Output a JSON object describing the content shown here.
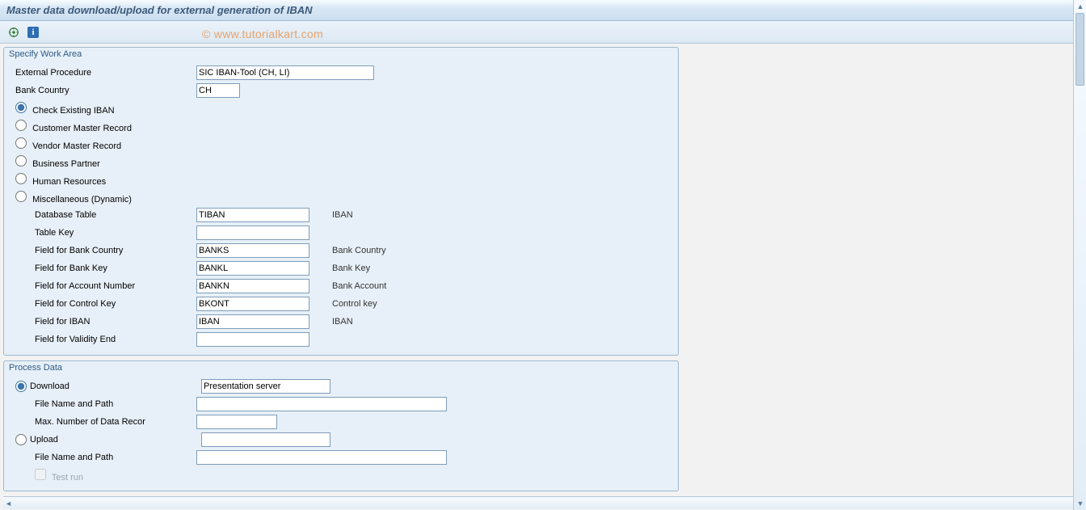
{
  "title": "Master data download/upload for external generation of IBAN",
  "watermark": "© www.tutorialkart.com",
  "groups": {
    "workarea": {
      "title": "Specify Work Area",
      "external_procedure": {
        "label": "External Procedure",
        "value": "SIC IBAN-Tool  (CH, LI)"
      },
      "bank_country": {
        "label": "Bank Country",
        "value": "CH"
      },
      "radios": {
        "check_iban": "Check Existing IBAN",
        "customer": "Customer Master Record",
        "vendor": "Vendor Master Record",
        "bp": "Business Partner",
        "hr": "Human Resources",
        "misc": "Miscellaneous (Dynamic)"
      },
      "misc_fields": {
        "db_table": {
          "label": "Database Table",
          "value": "TIBAN",
          "desc": "IBAN"
        },
        "table_key": {
          "label": "Table Key",
          "value": "",
          "desc": ""
        },
        "f_country": {
          "label": "Field for Bank Country",
          "value": "BANKS",
          "desc": "Bank Country"
        },
        "f_bankkey": {
          "label": "Field for Bank Key",
          "value": "BANKL",
          "desc": "Bank Key"
        },
        "f_account": {
          "label": "Field for Account Number",
          "value": "BANKN",
          "desc": "Bank Account"
        },
        "f_ctrlkey": {
          "label": "Field for Control Key",
          "value": "BKONT",
          "desc": "Control key"
        },
        "f_iban": {
          "label": "Field for IBAN",
          "value": "IBAN",
          "desc": "IBAN"
        },
        "f_validend": {
          "label": "Field for Validity End",
          "value": "",
          "desc": ""
        }
      }
    },
    "process": {
      "title": "Process Data",
      "download": {
        "label": "Download",
        "target": "Presentation server",
        "file_label": "File Name and Path",
        "file_value": "",
        "max_label": "Max. Number of Data Recor",
        "max_value": ""
      },
      "upload": {
        "label": "Upload",
        "target": "",
        "file_label": "File Name and Path",
        "file_value": "",
        "test_label": "Test run"
      }
    }
  }
}
